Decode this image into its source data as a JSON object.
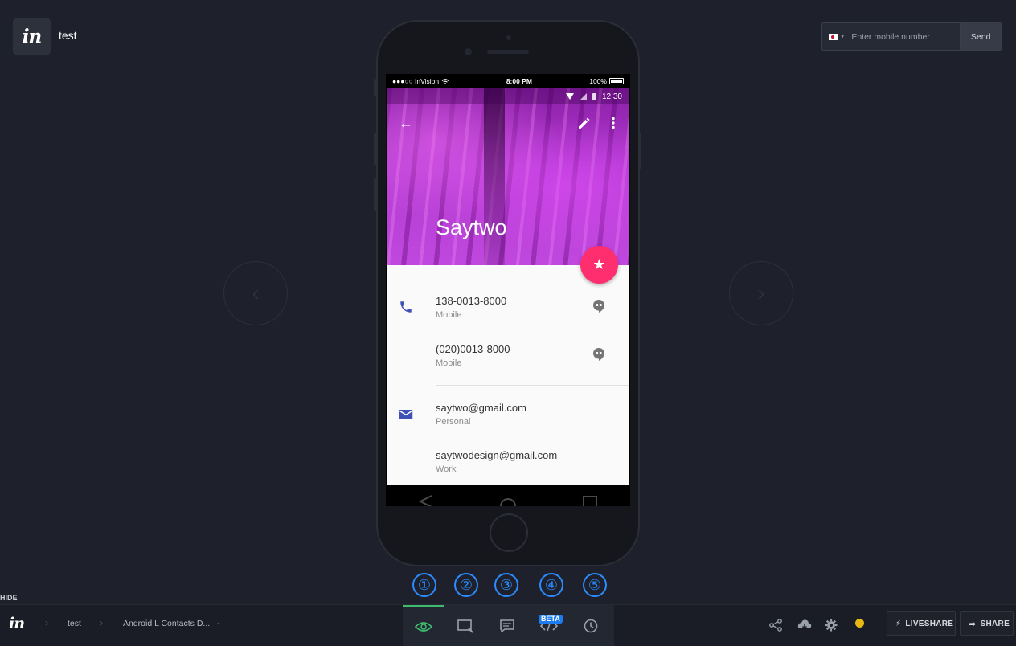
{
  "header": {
    "logo_text": "in",
    "project_title": "test"
  },
  "sms": {
    "placeholder": "Enter mobile number",
    "send_label": "Send"
  },
  "nav": {
    "prev_glyph": "‹",
    "next_glyph": "›"
  },
  "ios_status": {
    "carrier": "●●●○○ InVision",
    "time": "8:00 PM",
    "battery": "100%"
  },
  "android_status": {
    "time": "12:30"
  },
  "contact": {
    "name": "Saytwo",
    "phones": [
      {
        "number": "138-0013-8000",
        "type": "Mobile"
      },
      {
        "number": "(020)0013-8000",
        "type": "Mobile"
      }
    ],
    "emails": [
      {
        "address": "saytwo@gmail.com",
        "type": "Personal"
      },
      {
        "address": "saytwodesign@gmail.com",
        "type": "Work"
      }
    ]
  },
  "steps": [
    "①",
    "②",
    "③",
    "④",
    "⑤"
  ],
  "hide_label": "HIDE",
  "bottom_bar": {
    "logo_text": "in",
    "breadcrumb_project": "test",
    "breadcrumb_screen": "Android L Contacts D...",
    "breadcrumb_caret": "-",
    "beta_badge": "BETA",
    "liveshare_label": "LIVESHARE",
    "share_label": "SHARE"
  },
  "colors": {
    "background": "#1e212b",
    "fab": "#ff2e6e",
    "active_mode": "#3dbb6f",
    "step_blue": "#2a8cff",
    "status_dot": "#e8b911",
    "contact_icon": "#3f51b5"
  }
}
